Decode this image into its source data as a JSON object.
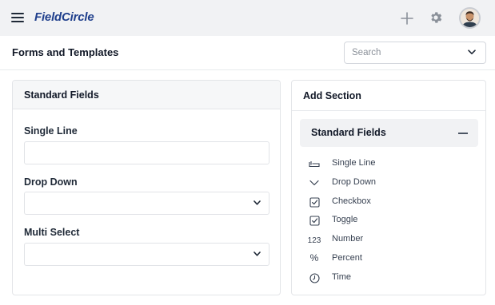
{
  "app": {
    "logo": "FieldCircle"
  },
  "header": {
    "title": "Forms and Templates",
    "search_placeholder": "Search"
  },
  "left_panel": {
    "title": "Standard Fields",
    "fields": [
      {
        "label": "Single Line",
        "type": "text"
      },
      {
        "label": "Drop Down",
        "type": "select"
      },
      {
        "label": "Multi Select",
        "type": "select"
      }
    ]
  },
  "right_panel": {
    "title": "Add Section",
    "accordion_title": "Standard Fields",
    "items": [
      {
        "label": "Single Line",
        "icon": "single-line-icon"
      },
      {
        "label": "Drop Down",
        "icon": "chevron-down-icon"
      },
      {
        "label": "Checkbox",
        "icon": "checkbox-icon"
      },
      {
        "label": "Toggle",
        "icon": "checkbox-icon"
      },
      {
        "label": "Number",
        "icon": "number-icon",
        "icon_text": "123"
      },
      {
        "label": "Percent",
        "icon": "percent-icon",
        "icon_text": "%"
      },
      {
        "label": "Time",
        "icon": "clock-icon"
      }
    ]
  },
  "colors": {
    "brand": "#1f3f8c",
    "topbar_bg": "#f1f2f4",
    "panel_border": "#e3e5e8"
  }
}
